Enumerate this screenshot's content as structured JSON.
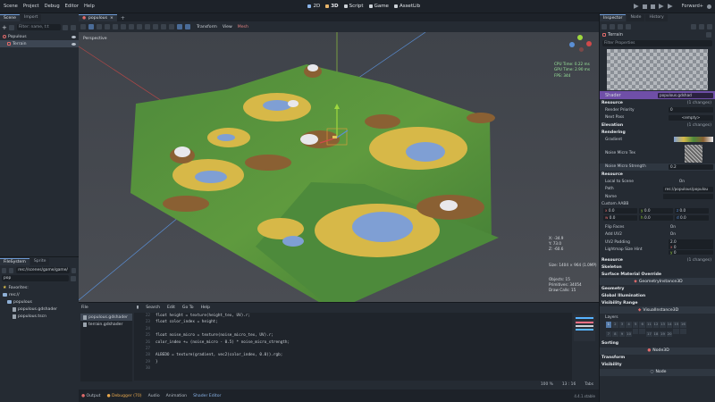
{
  "menu": [
    "Scene",
    "Project",
    "Debug",
    "Editor",
    "Help"
  ],
  "workspaces": [
    "2D",
    "3D",
    "Script",
    "Game",
    "AssetLib"
  ],
  "renderer": "Forward+",
  "scene_dock": {
    "tabs": [
      "Scene",
      "Import"
    ],
    "filter_placeholder": "Filter: name, t:t",
    "nodes": [
      "Populous",
      "Terrain"
    ]
  },
  "filesystem_dock": {
    "tabs": [
      "FileSystem",
      "Sprite"
    ],
    "path": "res://scenes/game/game/",
    "search": "pop",
    "items": [
      "Favorites:",
      "res://",
      "populous",
      "populous.gdshader",
      "populous.tscn"
    ]
  },
  "scene_tab": "populous",
  "viewport": {
    "toolbar": [
      "Transform",
      "View",
      "Mesh"
    ],
    "perspective": "Perspective",
    "stats": [
      "CPU Time: 0.22 ms",
      "GPU Time: 2.90 ms",
      "FPS: 344"
    ],
    "coords": [
      "X: -34.9",
      "Y: 73.0",
      "Z: -60.6"
    ],
    "size": "Size: 1404 × 964 (1.0MP)",
    "counts": [
      "Objects: 15",
      "Primitives: 34054",
      "Draw Calls: 15"
    ]
  },
  "editor": {
    "menu": [
      "File",
      "Search",
      "Edit",
      "Go To",
      "Help"
    ],
    "files": [
      "populous.gdshader",
      "terrain.gdshader"
    ],
    "lines": [
      {
        "n": "22",
        "code": "float height = texture(height_tex, UV).r;"
      },
      {
        "n": "23",
        "code": "float color_index = height;"
      },
      {
        "n": "24",
        "code": ""
      },
      {
        "n": "25",
        "code": "float noise_micro = texture(noise_micro_tex, UV).r;"
      },
      {
        "n": "26",
        "code": "color_index += (noise_micro - 0.5) * noise_micro_strength;"
      },
      {
        "n": "27",
        "code": ""
      },
      {
        "n": "28",
        "code": "ALBEDO = texture(gradient, vec2(color_index, 0.0)).rgb;"
      },
      {
        "n": "29",
        "code": "}"
      },
      {
        "n": "30",
        "code": ""
      }
    ],
    "zoom": "100 %",
    "position": "13 : 16",
    "indent": "Tabs"
  },
  "bottom_tabs": [
    "Output",
    "Debugger (70)",
    "Audio",
    "Animation",
    "Shader Editor"
  ],
  "version": "4.4.1.stable",
  "inspector": {
    "tabs": [
      "Inspector",
      "Node",
      "History"
    ],
    "node": "Terrain",
    "filter_placeholder": "Filter Properties",
    "shader_label": "Shader",
    "shader_file": "populous.gdshad",
    "sections": {
      "resource": "Resource",
      "changes": "(1 changes)",
      "render_priority": "Render Priority",
      "render_priority_value": "0",
      "next_pass": "Next Pass",
      "next_pass_value": "<empty>",
      "elevation": "Elevation",
      "elevation_changes": "(1 changes)",
      "rendering": "Rendering",
      "gradient": "Gradient",
      "noise_micro_tex": "Noise Micro Tex",
      "noise_micro_strength": "Noise Micro Strength",
      "noise_micro_strength_value": "0.2",
      "resource2": "Resource",
      "local_to_scene": "Local to Scene",
      "local_to_scene_value": "On",
      "path": "Path",
      "path_value": "res://populous/populou",
      "name": "Name",
      "custom_aabb": "Custom AABB",
      "flip_faces": "Flip Faces",
      "flip_faces_value": "On",
      "add_uv2": "Add UV2",
      "add_uv2_value": "On",
      "uv2_padding": "UV2 Padding",
      "uv2_padding_value": "2.0",
      "lightmap": "Lightmap Size Hint",
      "resource3": "Resource",
      "resource3_changes": "(1 changes)",
      "skeleton": "Skeleton",
      "surface": "Surface Material Override",
      "geometry_instance": "GeometryInstance3D",
      "geometry": "Geometry",
      "gi": "Global Illumination",
      "visibility_range": "Visibility Range",
      "visual_instance": "VisualInstance3D",
      "layers": "Layers",
      "sorting": "Sorting",
      "node3d": "Node3D",
      "transform": "Transform",
      "visibility": "Visibility",
      "node": "Node"
    },
    "aabb": [
      "x",
      "0.0",
      "y",
      "0.0",
      "z",
      "0.0",
      "w",
      "0.0",
      "h",
      "0.0",
      "d",
      "0.0"
    ],
    "lightmap_values": [
      "x",
      "0",
      "y",
      "0"
    ],
    "layers_top": [
      "1",
      "2",
      "3",
      "4",
      "5",
      "6",
      "11",
      "12",
      "13",
      "14",
      "15",
      "16"
    ],
    "layers_bottom": [
      "7",
      "8",
      "9",
      "10",
      "",
      "",
      "17",
      "18",
      "19",
      "20",
      "",
      ""
    ]
  }
}
